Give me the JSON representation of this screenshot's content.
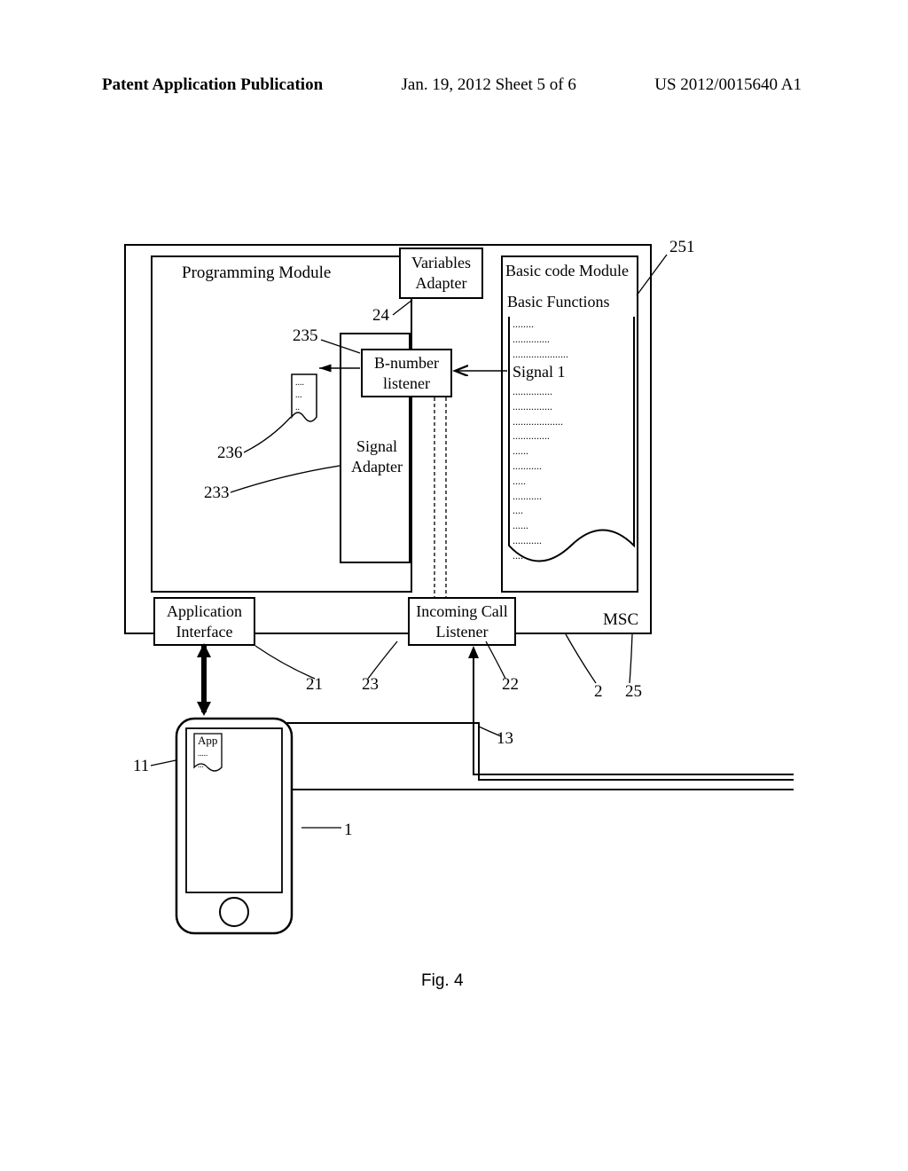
{
  "header": {
    "left": "Patent Application Publication",
    "center": "Jan. 19, 2012  Sheet 5 of 6",
    "right": "US 2012/0015640 A1"
  },
  "labels": {
    "programming_module": "Programming Module",
    "variables_adapter": "Variables Adapter",
    "basic_code_module": "Basic code Module",
    "basic_functions": "Basic Functions",
    "signal1": "Signal 1",
    "bnumber_listener": "B-number listener",
    "signal_adapter": "Signal Adapter",
    "app_interface": "Application Interface",
    "incoming_listener": "Incoming Call Listener",
    "msc": "MSC",
    "app": "App",
    "fig": "Fig. 4"
  },
  "refs": {
    "r251": "251",
    "r24": "24",
    "r235": "235",
    "r236": "236",
    "r233": "233",
    "r21": "21",
    "r23": "23",
    "r22": "22",
    "r2": "2",
    "r25": "25",
    "r13": "13",
    "r11": "11",
    "r1": "1"
  }
}
